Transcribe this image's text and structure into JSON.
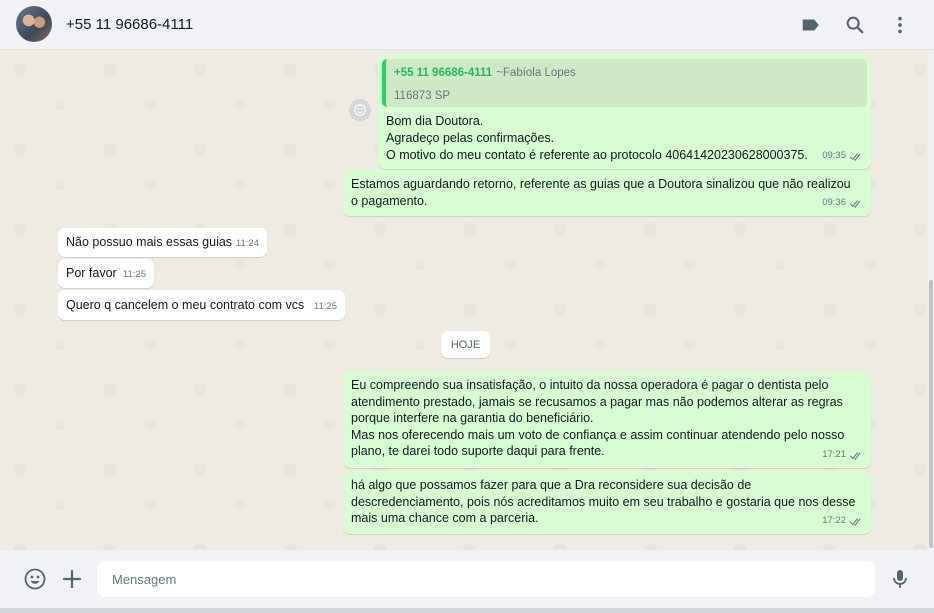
{
  "header": {
    "contact_name": "+55 11 96686-4111",
    "icons": [
      "label-icon",
      "search-icon",
      "menu-icon"
    ]
  },
  "messages": {
    "m1": {
      "quote_name": "+55 11 96686-4111",
      "quote_alias": "~Fabíola Lopes",
      "quote_text": "116873 SP",
      "text": "Bom dia Doutora.\nAgradeço pelas confirmações.\nO motivo do meu contato é referente ao protocolo 40641420230628000375.",
      "time": "09:35"
    },
    "m2": {
      "text": "Estamos aguardando retorno, referente as guias que a Doutora sinalizou que não realizou\no pagamento.",
      "time": "09:36"
    },
    "m3": {
      "text": "Não possuo mais essas guias",
      "time": "11:24"
    },
    "m4": {
      "text": "Por favor",
      "time": "11:25"
    },
    "m5": {
      "text": "Quero q cancelem o meu contrato com vcs",
      "time": "11:25"
    },
    "date_chip": "HOJE",
    "m6": {
      "text": "Eu compreendo sua insatisfação, o intuito da nossa operadora é pagar o dentista pelo\natendimento prestado, jamais se recusamos a pagar mas não podemos alterar as regras\nporque interfere na garantia do beneficiário.\nMas nos oferecendo mais um voto de confiança e assim continuar atendendo pelo nosso\nplano, te darei todo suporte daqui para frente.",
      "time": "17:21"
    },
    "m7": {
      "text": "há algo que possamos fazer para que a Dra reconsidere sua decisão de\ndescredenciamento, pois nós acreditamos muito em seu trabalho e gostaria que nos desse\nmais uma chance com a parceria.",
      "time": "17:22"
    }
  },
  "composer": {
    "placeholder": "Mensagem",
    "icons": [
      "emoji-icon",
      "attach-plus-icon",
      "microphone-icon"
    ]
  },
  "colors": {
    "outgoing_bubble": "#d9fdd3",
    "incoming_bubble": "#ffffff",
    "chat_background": "#efeae2",
    "quote_accent": "#25d366"
  }
}
